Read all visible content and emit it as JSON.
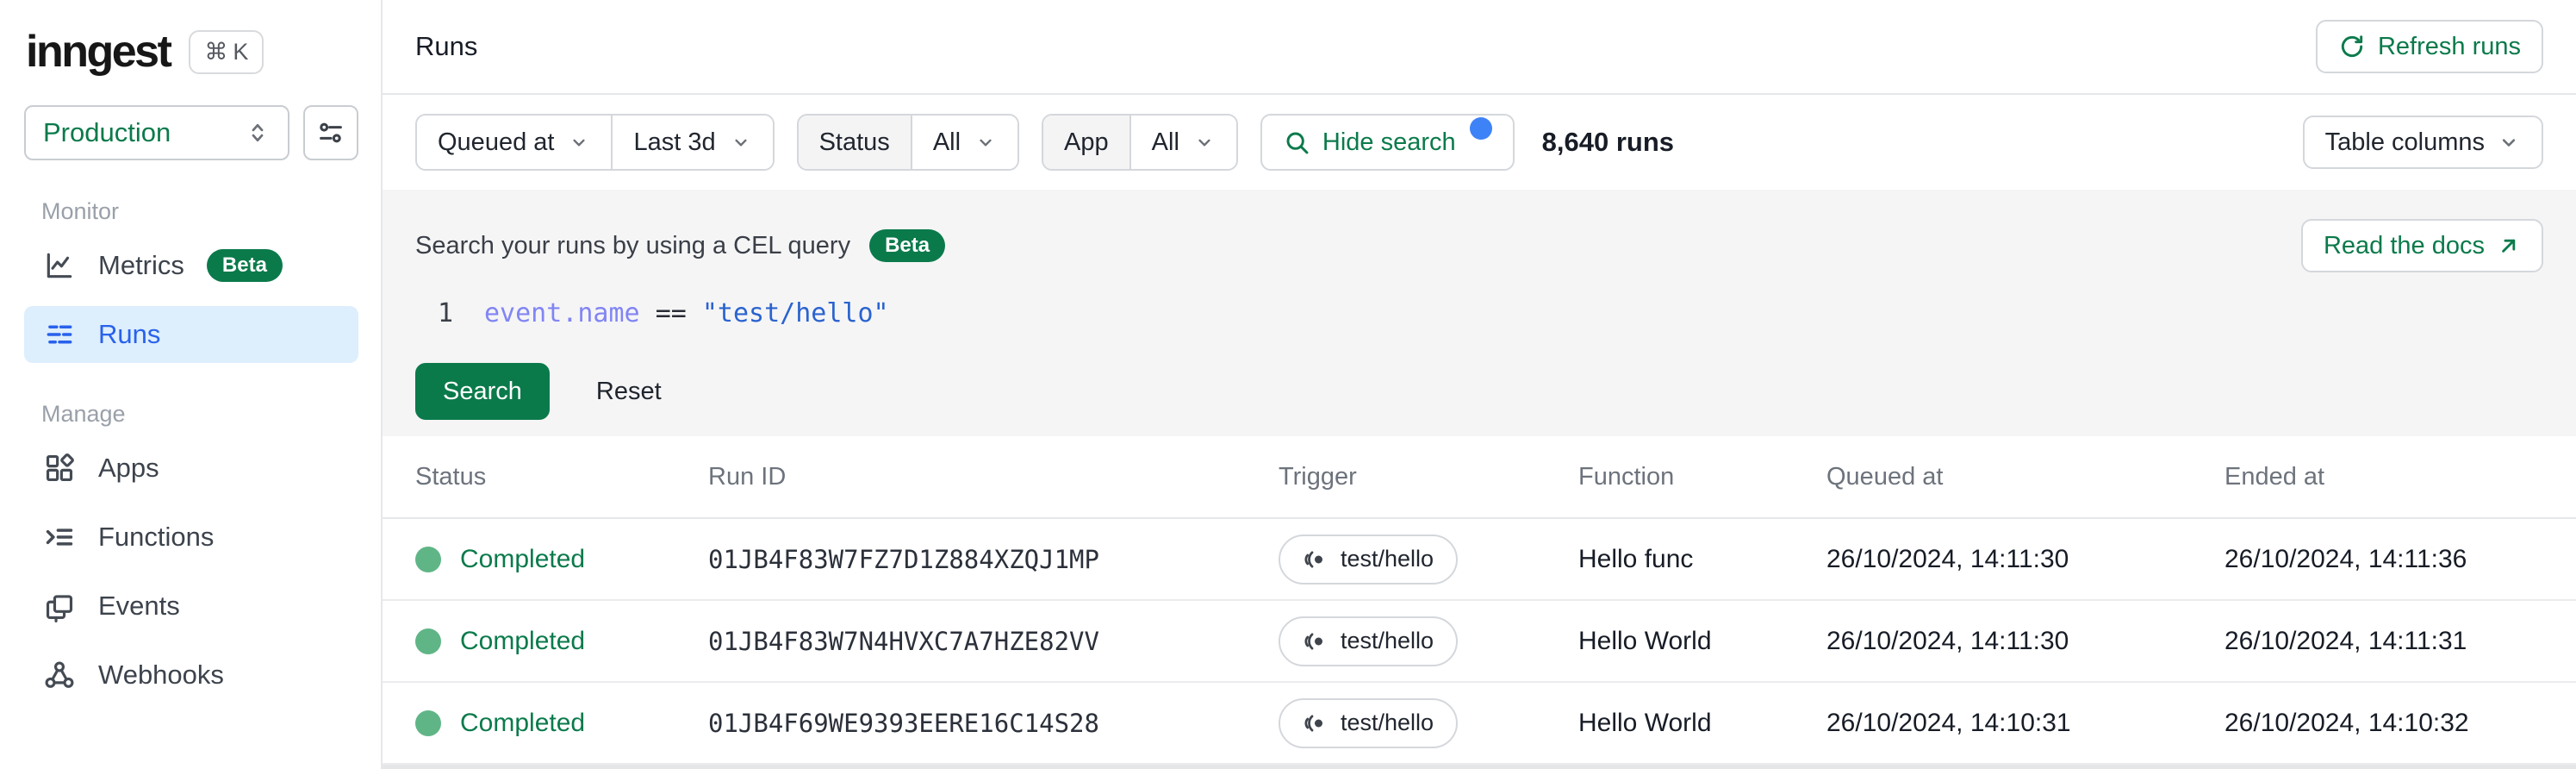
{
  "colors": {
    "brand_green": "#0b7a4b",
    "active_blue": "#2861ec",
    "active_blue_bg": "#ddeefd",
    "status_dot_green": "#60b586",
    "notification_dot_blue": "#3e82f7",
    "code_property": "#8185f3",
    "code_string": "#2a63cf",
    "panel_gray": "#f5f5f6"
  },
  "sidebar": {
    "logo_text": "inngest",
    "shortcut_cmd": "⌘",
    "shortcut_key": "K",
    "environment": "Production",
    "sections": [
      {
        "label": "Monitor",
        "items": [
          {
            "label": "Metrics",
            "badge": "Beta"
          },
          {
            "label": "Runs"
          }
        ]
      },
      {
        "label": "Manage",
        "items": [
          {
            "label": "Apps"
          },
          {
            "label": "Functions"
          },
          {
            "label": "Events"
          },
          {
            "label": "Webhooks"
          }
        ]
      }
    ]
  },
  "header": {
    "title": "Runs",
    "refresh_label": "Refresh runs"
  },
  "filters": {
    "time_field": {
      "label": "Queued at"
    },
    "time_range": {
      "label": "Last 3d"
    },
    "status": {
      "label": "Status",
      "value": "All"
    },
    "app": {
      "label": "App",
      "value": "All"
    },
    "hide_search_label": "Hide search",
    "runs_count": "8,640 runs",
    "table_columns_label": "Table columns"
  },
  "search": {
    "title": "Search your runs by using a CEL query",
    "beta_badge": "Beta",
    "docs_label": "Read the docs",
    "code": {
      "line_number": "1",
      "object": "event",
      "dot": ".",
      "property": "name",
      "operator": "==",
      "string_value": "\"test/hello\""
    },
    "search_button": "Search",
    "reset_button": "Reset"
  },
  "table": {
    "columns": [
      "Status",
      "Run ID",
      "Trigger",
      "Function",
      "Queued at",
      "Ended at"
    ],
    "rows": [
      {
        "status": "Completed",
        "run_id": "01JB4F83W7FZ7D1Z884XZQJ1MP",
        "trigger": "test/hello",
        "function": "Hello func",
        "queued_at": "26/10/2024, 14:11:30",
        "ended_at": "26/10/2024, 14:11:36"
      },
      {
        "status": "Completed",
        "run_id": "01JB4F83W7N4HVXC7A7HZE82VV",
        "trigger": "test/hello",
        "function": "Hello World",
        "queued_at": "26/10/2024, 14:11:30",
        "ended_at": "26/10/2024, 14:11:31"
      },
      {
        "status": "Completed",
        "run_id": "01JB4F69WE9393EERE16C14S28",
        "trigger": "test/hello",
        "function": "Hello World",
        "queued_at": "26/10/2024, 14:10:31",
        "ended_at": "26/10/2024, 14:10:32"
      }
    ]
  }
}
